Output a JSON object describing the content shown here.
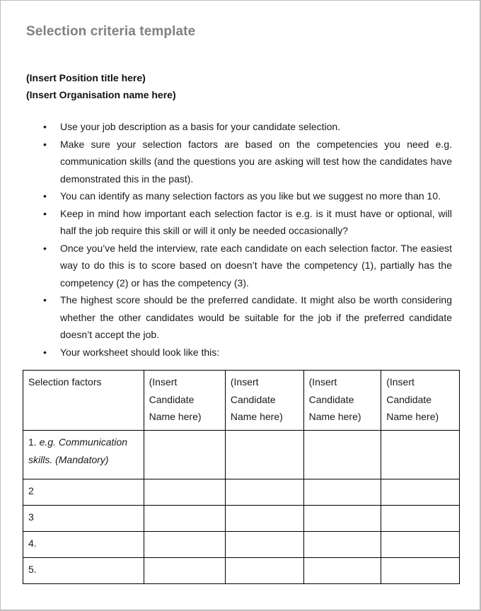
{
  "document": {
    "title": "Selection criteria template",
    "position_placeholder": "(Insert Position title here)",
    "organisation_placeholder": "(Insert Organisation name here)",
    "bullets": [
      "Use your job description as a basis for your candidate selection.",
      "Make sure your selection factors are based on the competencies you need e.g. communication skills (and the questions you are asking will test how the candidates have demonstrated this in the past).",
      "You can identify as many selection factors as you like but we suggest no more than 10.",
      "Keep in mind how important each selection factor is e.g. is it must have or optional, will half the job require this skill or will it only be needed occasionally?",
      "Once you’ve held the interview, rate each candidate on each selection factor. The easiest way to do this is to score based on doesn’t have the competency (1), partially has the competency (2) or has the competency (3).",
      "The highest score should be the preferred candidate. It might also be worth considering whether the other candidates would be suitable for the job if the preferred candidate doesn’t accept the job.",
      "Your worksheet should look like this:"
    ],
    "bullet_glyph": "•"
  },
  "worksheet": {
    "headers": [
      "Selection factors",
      "(Insert Candidate Name here)",
      "(Insert Candidate Name here)",
      "(Insert Candidate Name here)",
      "(Insert Candidate Name here)"
    ],
    "rows": [
      {
        "number": "1.",
        "example": "e.g. Communication skills. (Mandatory)"
      },
      {
        "number": "2",
        "example": ""
      },
      {
        "number": "3",
        "example": ""
      },
      {
        "number": "4.",
        "example": ""
      },
      {
        "number": "5.",
        "example": ""
      }
    ]
  }
}
